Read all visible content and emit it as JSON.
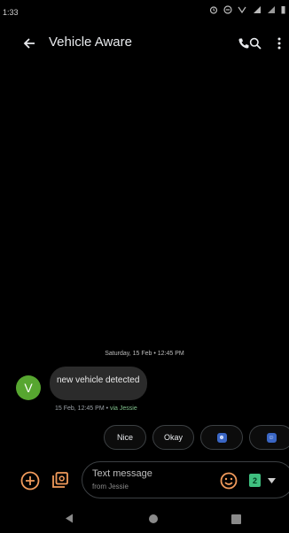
{
  "status_bar": {
    "time": "1:33"
  },
  "app_bar": {
    "title": "Vehicle Aware"
  },
  "conversation": {
    "date_separator": "Saturday, 15 Feb • 12:45 PM",
    "messages": [
      {
        "avatar_letter": "V",
        "text": "new vehicle detected",
        "meta_time": "15 Feb, 12:45 PM • ",
        "meta_via": "via Jessie"
      }
    ]
  },
  "smart_replies": [
    {
      "label": "Nice"
    },
    {
      "label": "Okay"
    },
    {
      "icon": "emoji-icon"
    },
    {
      "icon": "emoji-icon"
    }
  ],
  "compose": {
    "placeholder": "Text message",
    "sub_label": "from Jessie",
    "sim_number": "2"
  },
  "colors": {
    "background": "#000000",
    "avatar": "#57a630",
    "bubble": "#2b2b2b",
    "accent": "#f29b5c",
    "sim_badge": "#3fbf7f"
  }
}
